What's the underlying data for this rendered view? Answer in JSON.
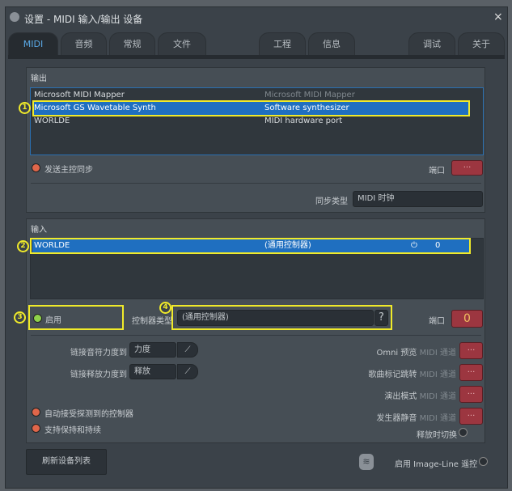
{
  "window": {
    "title": "设置 - MIDI 输入/输出 设备",
    "close": "×"
  },
  "tabs": [
    {
      "label": "MIDI",
      "active": true
    },
    {
      "label": "音频"
    },
    {
      "label": "常规"
    },
    {
      "label": "文件"
    },
    {
      "label": "工程"
    },
    {
      "label": "信息"
    },
    {
      "label": "调试"
    },
    {
      "label": "关于"
    }
  ],
  "output": {
    "label": "输出",
    "devices": [
      {
        "name": "Microsoft MIDI Mapper",
        "type": "Microsoft MIDI Mapper"
      },
      {
        "name": "Microsoft GS Wavetable Synth",
        "type": "Software synthesizer",
        "selected": true
      },
      {
        "name": "WORLDE",
        "type": "MIDI hardware port"
      }
    ],
    "send_sync": "发送主控同步",
    "port_label": "端口",
    "port_value": "···",
    "sync_type_label": "同步类型",
    "sync_type_value": "MIDI 时钟"
  },
  "input": {
    "label": "输入",
    "devices": [
      {
        "name": "WORLDE",
        "controller": "(通用控制器)",
        "port": "0",
        "selected": true
      }
    ],
    "enable": "启用",
    "controller_type_label": "控制器类型",
    "controller_type_value": "(通用控制器)",
    "help": "?",
    "port_label": "端口",
    "port_value": "0",
    "link_velocity_label": "链接音符力度到",
    "link_velocity_value": "力度",
    "link_release_label": "链接释放力度到",
    "link_release_value": "释放",
    "channels": [
      {
        "label": "Omni 预览",
        "suffix": "MIDI 通道",
        "value": "···"
      },
      {
        "label": "歌曲标记跳转",
        "suffix": "MIDI 通道",
        "value": "···"
      },
      {
        "label": "演出模式",
        "suffix": "MIDI 通道",
        "value": "···"
      },
      {
        "label": "发生器静音",
        "suffix": "MIDI 通道",
        "value": "···"
      }
    ],
    "toggle_on_release": "释放时切换",
    "auto_accept": "自动接受探测到的控制器",
    "support_hold": "支持保持和持续"
  },
  "footer": {
    "refresh": "刷新设备列表",
    "remote": "启用 Image-Line 遥控"
  },
  "annotations": [
    "1",
    "2",
    "3",
    "4"
  ],
  "colors": {
    "accent": "#1f6fc0",
    "annotation": "#f0ea2a",
    "port_button": "#9c3640"
  }
}
